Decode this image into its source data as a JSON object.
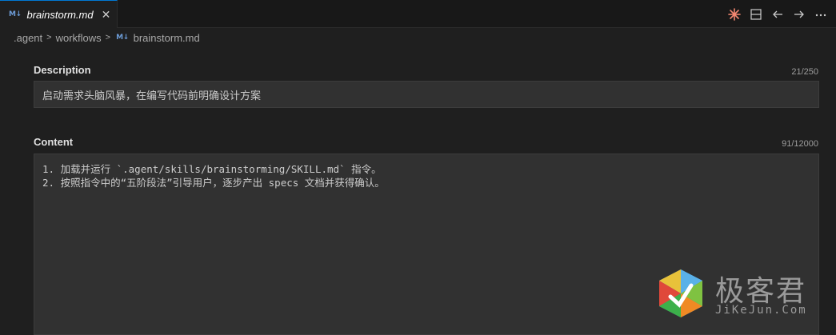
{
  "tab": {
    "icon": "M↓",
    "title": "brainstorm.md",
    "close": "✕"
  },
  "actions": [
    "spark-icon",
    "split-editor-icon",
    "go-back-icon",
    "go-forward-icon",
    "more-actions-icon"
  ],
  "breadcrumb": {
    "part1": ".agent",
    "part2": "workflows",
    "icon": "M↓",
    "part3": "brainstorm.md"
  },
  "description": {
    "label": "Description",
    "counter": "21/250",
    "value": "启动需求头脑风暴，在编写代码前明确设计方案"
  },
  "content": {
    "label": "Content",
    "counter": "91/12000",
    "value": "1. 加载并运行 `.agent/skills/brainstorming/SKILL.md` 指令。\n2. 按照指令中的“五阶段法”引导用户，逐步产出 specs 文档并获得确认。"
  },
  "watermark": {
    "text": "极客君",
    "url": "JiKeJun.Com"
  },
  "colors": {
    "accent": "#0078d4",
    "background": "#1f1f1f",
    "input_bg": "#313131"
  }
}
